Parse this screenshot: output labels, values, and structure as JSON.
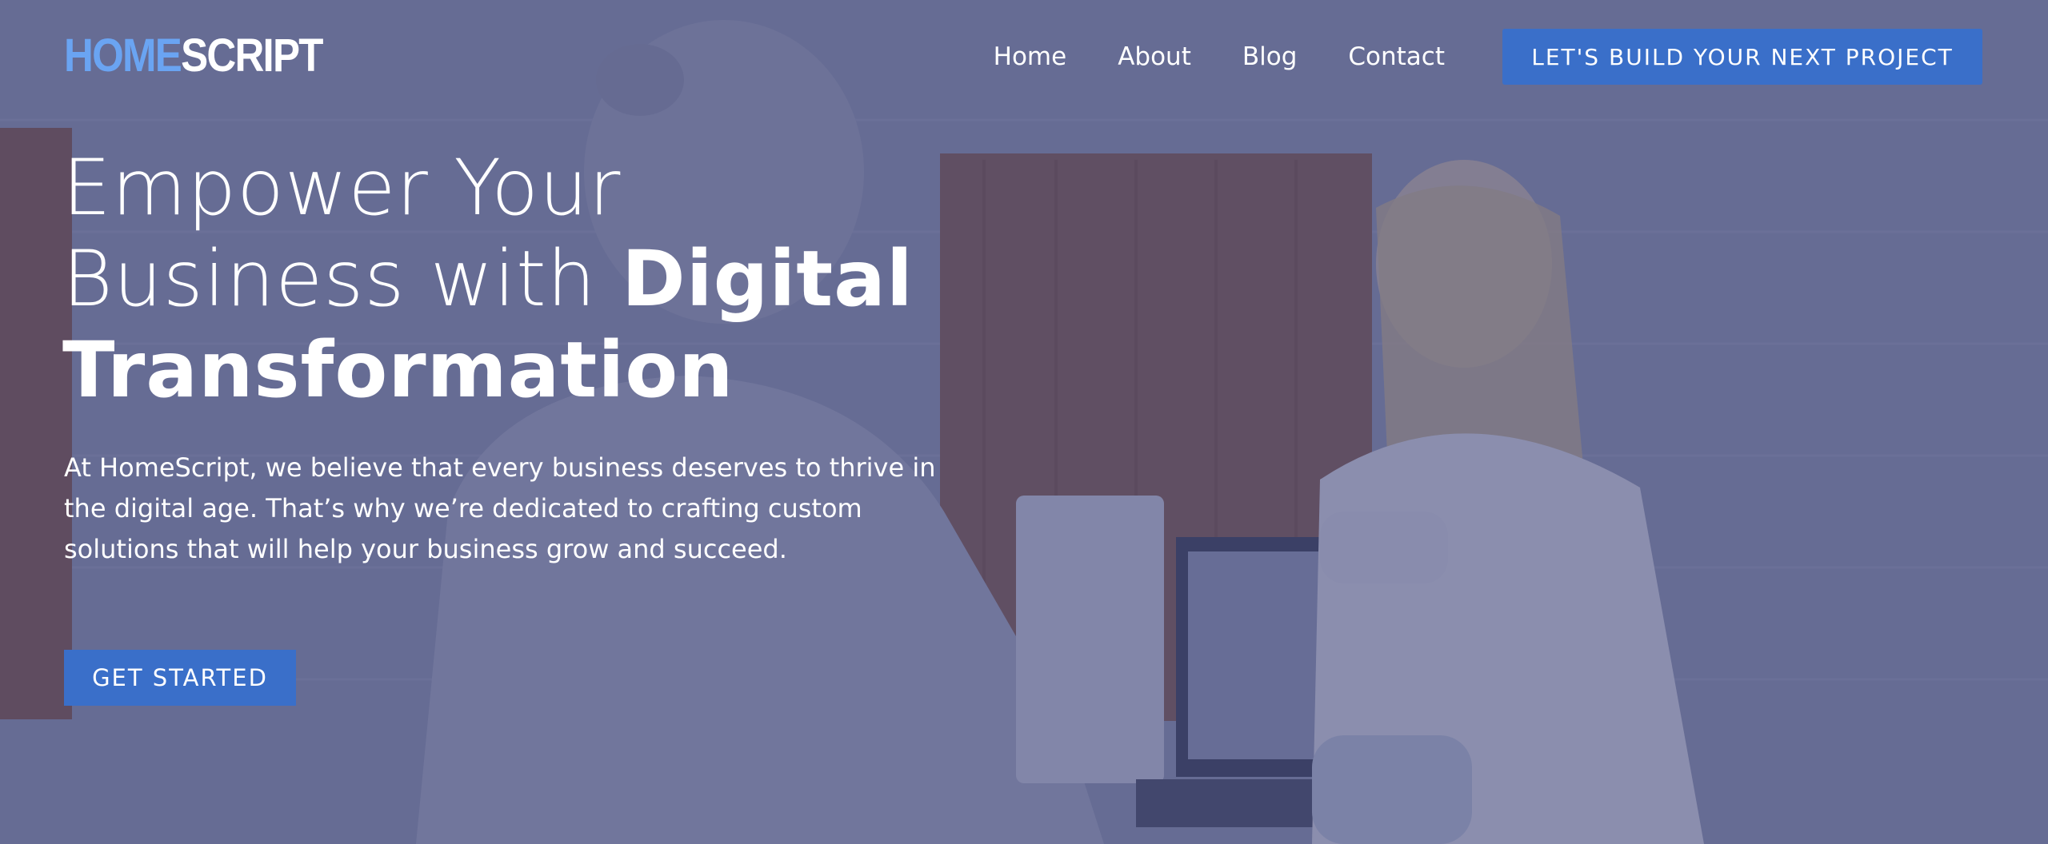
{
  "logo": {
    "part1": "HOME",
    "part2": "SCRIPT"
  },
  "nav": {
    "items": [
      "Home",
      "About",
      "Blog",
      "Contact"
    ],
    "cta": "LET'S BUILD YOUR NEXT PROJECT"
  },
  "hero": {
    "line1": "Empower Your",
    "line2_light": "Business with ",
    "line2_bold": "Digital",
    "line3_bold": "Transformation",
    "paragraph": "At HomeScript, we believe that every business deserves to thrive in the digital age. That’s why we’re dedicated to crafting custom solutions that will help your business grow and succeed.",
    "button": "GET STARTED"
  },
  "colors": {
    "accent": "#3a6fc9",
    "logo_highlight": "#6aa4f2",
    "overlay": "#484e80"
  }
}
